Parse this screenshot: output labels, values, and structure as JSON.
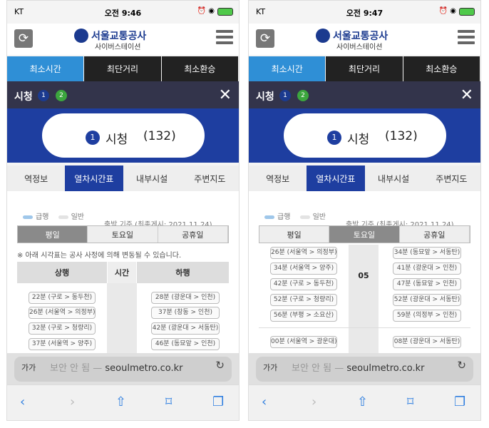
{
  "phones": [
    {
      "status": {
        "carrier": "KT",
        "time": "오전 9:46"
      },
      "day_active": 0,
      "up": [
        "22분 (구로 > 동두천)",
        "26분 (서울역 > 의정부)",
        "32분 (구로 > 청량리)",
        "37분 (서울역 > 양주)"
      ],
      "down": [
        "28분 (광운대 > 인천)",
        "37분 (창동 > 인천)",
        "42분 (광운대 > 서동탄)",
        "46분 (동묘앞 > 인천)"
      ]
    },
    {
      "status": {
        "carrier": "KT",
        "time": "오전 9:47"
      },
      "day_active": 1,
      "hour": "05",
      "up": [
        "26분 (서울역 > 의정부)",
        "34분 (서울역 > 양주)",
        "42분 (구로 > 동두천)",
        "52분 (구로 > 청량리)",
        "56분 (부평 > 소요산)",
        "00분 (서울역 > 광운대)"
      ],
      "down": [
        "34분 (동묘앞 > 서동탄)",
        "41분 (광운대 > 인천)",
        "47분 (동묘앞 > 인천)",
        "52분 (광운대 > 서동탄)",
        "59분 (의정부 > 인천)",
        "08분 (광운대 > 서동탄)"
      ]
    }
  ],
  "header": {
    "logo_title": "서울교통공사",
    "logo_sub": "사이버스테이션"
  },
  "search_tabs": [
    "최소시간",
    "최단거리",
    "최소환승"
  ],
  "station": {
    "name": "시청",
    "badge1": "1",
    "badge2": "2",
    "code": "(132)",
    "line": "1"
  },
  "info_tabs": [
    "역정보",
    "열차시간표",
    "내부시설",
    "주변지도"
  ],
  "legend": {
    "express": "급행",
    "normal": "일반"
  },
  "reference": "출발 기준 (최종게시: 2021.11.24)",
  "day_tabs": [
    "평일",
    "토요일",
    "공휴일"
  ],
  "notice": "※ 아래 시각표는 공사 사정에 의해 변동될 수 있습니다.",
  "table": {
    "up": "상행",
    "time": "시간",
    "down": "하행"
  },
  "address": {
    "aa": "가가",
    "insecure": "보안 안 됨 —",
    "domain": "seoulmetro.co.kr"
  },
  "colors": {
    "accent": "#1e3ea0",
    "tab_active": "#2f8fd6",
    "line2": "#3ca63e"
  }
}
